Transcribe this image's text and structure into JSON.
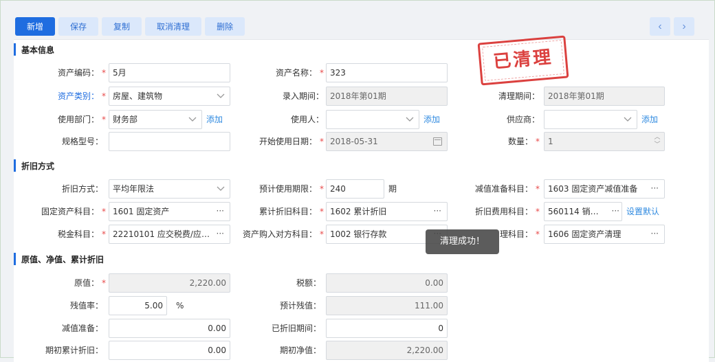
{
  "toolbar": {
    "new": "新增",
    "save": "保存",
    "copy": "复制",
    "cancel_cleanup": "取消清理",
    "delete": "删除"
  },
  "pager": {
    "prev": "‹",
    "next": "›"
  },
  "stamp": "已清理",
  "toast": "清理成功！",
  "sections": {
    "basic": "基本信息",
    "depreciation": "折旧方式",
    "value": "原值、净值、累计折旧"
  },
  "basic": {
    "asset_code": {
      "label": "资产编码：",
      "value": "5月"
    },
    "asset_name": {
      "label": "资产名称：",
      "value": "323"
    },
    "asset_category": {
      "label": "资产类别：",
      "value": "房屋、建筑物"
    },
    "entry_period": {
      "label": "录入期间：",
      "value": "2018年第01期"
    },
    "cleanup_period": {
      "label": "清理期间：",
      "value": "2018年第01期"
    },
    "department": {
      "label": "使用部门：",
      "value": "财务部",
      "add": "添加"
    },
    "user": {
      "label": "使用人：",
      "value": "",
      "add": "添加"
    },
    "supplier": {
      "label": "供应商：",
      "value": "",
      "add": "添加"
    },
    "spec": {
      "label": "规格型号：",
      "value": ""
    },
    "start_date": {
      "label": "开始使用日期：",
      "value": "2018-05-31"
    },
    "quantity": {
      "label": "数量：",
      "value": "1"
    }
  },
  "depreciation": {
    "method": {
      "label": "折旧方式：",
      "value": "平均年限法"
    },
    "life": {
      "label": "预计使用期限：",
      "value": "240",
      "unit": "期"
    },
    "impairment_account": {
      "label": "减值准备科目：",
      "value": "1603 固定资产减值准备"
    },
    "fixed_asset_account": {
      "label": "固定资产科目：",
      "value": "1601 固定资产"
    },
    "accum_account": {
      "label": "累计折旧科目：",
      "value": "1602 累计折旧"
    },
    "expense_account": {
      "label": "折旧费用科目：",
      "value": "560114 销售费...",
      "link": "设置默认"
    },
    "tax_account": {
      "label": "税金科目：",
      "value": "22210101 应交税费/应交..."
    },
    "purchase_account": {
      "label": "资产购入对方科目：",
      "value": "1002 银行存款"
    },
    "cleanup_account": {
      "label": "理科目：",
      "value": "1606 固定资产清理"
    }
  },
  "value": {
    "original": {
      "label": "原值：",
      "value": "2,220.00"
    },
    "tax": {
      "label": "税额：",
      "value": "0.00"
    },
    "residual_rate": {
      "label": "残值率：",
      "value": "5.00",
      "unit": "%"
    },
    "expected_residual": {
      "label": "预计残值：",
      "value": "111.00"
    },
    "impairment": {
      "label": "减值准备：",
      "value": "0.00"
    },
    "depreciated_periods": {
      "label": "已折旧期间：",
      "value": "0"
    },
    "opening_accum": {
      "label": "期初累计折旧：",
      "value": "0.00"
    },
    "opening_net": {
      "label": "期初净值：",
      "value": "2,220.00"
    }
  },
  "required_mark": "*"
}
